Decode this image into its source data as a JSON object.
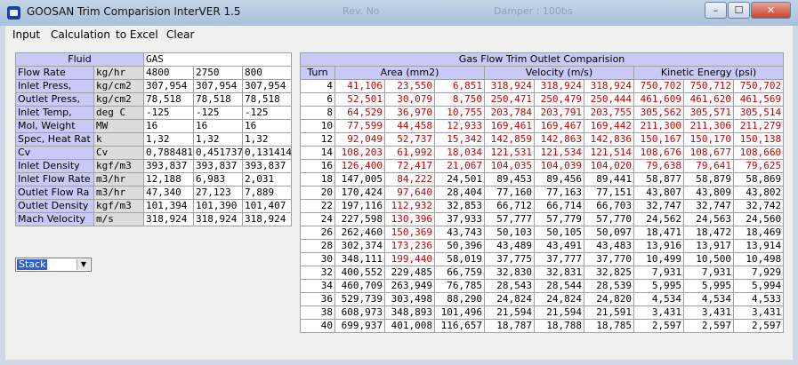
{
  "window": {
    "title": "GOOSAN Trim Comparision InterVER 1.5",
    "minimize": "–",
    "maximize": "☐",
    "close": "✕",
    "background_text": [
      "Rev. No",
      "Damper : 100bs"
    ]
  },
  "menu": [
    "Input",
    "Calculation",
    "to Excel",
    "Clear"
  ],
  "fluid_table": {
    "header_label": "Fluid",
    "header_value": "GAS",
    "rows": [
      {
        "label": "Flow Rate",
        "unit": "kg/hr",
        "values": [
          "4800",
          "2750",
          "800"
        ]
      },
      {
        "label": "Inlet Press,",
        "unit": "kg/cm2",
        "values": [
          "307,954",
          "307,954",
          "307,954"
        ]
      },
      {
        "label": "Outlet Press,",
        "unit": "kg/cm2",
        "values": [
          "78,518",
          "78,518",
          "78,518"
        ]
      },
      {
        "label": "Inlet Temp,",
        "unit": "deg C",
        "values": [
          "-125",
          "-125",
          "-125"
        ]
      },
      {
        "label": "Mol, Weight",
        "unit": "MW",
        "values": [
          "16",
          "16",
          "16"
        ]
      },
      {
        "label": "Spec, Heat Rat",
        "unit": "k",
        "values": [
          "1,32",
          "1,32",
          "1,32"
        ]
      },
      {
        "label": "Cv",
        "unit": "Cv",
        "values": [
          "0,788481",
          "0,451737",
          "0,131414"
        ]
      },
      {
        "label": "Inlet Density",
        "unit": "kgf/m3",
        "values": [
          "393,837",
          "393,837",
          "393,837"
        ]
      },
      {
        "label": "Inlet Flow Rate",
        "unit": "m3/hr",
        "values": [
          "12,188",
          "6,983",
          "2,031"
        ]
      },
      {
        "label": "Outlet Flow Ra",
        "unit": "m3/hr",
        "values": [
          "47,340",
          "27,123",
          "7,889"
        ]
      },
      {
        "label": "Outlet Density",
        "unit": "kgf/m3",
        "values": [
          "101,394",
          "101,390",
          "101,407"
        ]
      },
      {
        "label": "Mach Velocity",
        "unit": "m/s",
        "values": [
          "318,924",
          "318,924",
          "318,924"
        ]
      }
    ]
  },
  "combo": {
    "selected": "Stack"
  },
  "comparison": {
    "title": "Gas Flow Trim Outlet Comparision",
    "col_turn": "Turn",
    "groups": [
      "Area (mm2)",
      "Velocity (m/s)",
      "Kinetic Energy (psi)"
    ],
    "rows": [
      {
        "turn": "4",
        "v": [
          "41,106",
          "23,550",
          "6,851",
          "318,924",
          "318,924",
          "318,924",
          "750,702",
          "750,712",
          "750,702"
        ],
        "red": [
          1,
          1,
          1,
          1,
          1,
          1,
          1,
          1,
          1
        ]
      },
      {
        "turn": "6",
        "v": [
          "52,501",
          "30,079",
          "8,750",
          "250,471",
          "250,479",
          "250,444",
          "461,609",
          "461,620",
          "461,569"
        ],
        "red": [
          1,
          1,
          1,
          1,
          1,
          1,
          1,
          1,
          1
        ]
      },
      {
        "turn": "8",
        "v": [
          "64,529",
          "36,970",
          "10,755",
          "203,784",
          "203,791",
          "203,755",
          "305,562",
          "305,571",
          "305,514"
        ],
        "red": [
          1,
          1,
          1,
          1,
          1,
          1,
          1,
          1,
          1
        ]
      },
      {
        "turn": "10",
        "v": [
          "77,599",
          "44,458",
          "12,933",
          "169,461",
          "169,467",
          "169,442",
          "211,300",
          "211,306",
          "211,279"
        ],
        "red": [
          1,
          1,
          1,
          1,
          1,
          1,
          1,
          1,
          1
        ]
      },
      {
        "turn": "12",
        "v": [
          "92,049",
          "52,737",
          "15,342",
          "142,859",
          "142,863",
          "142,836",
          "150,167",
          "150,170",
          "150,138"
        ],
        "red": [
          1,
          1,
          1,
          1,
          1,
          1,
          1,
          1,
          1
        ]
      },
      {
        "turn": "14",
        "v": [
          "108,203",
          "61,992",
          "18,034",
          "121,531",
          "121,534",
          "121,514",
          "108,676",
          "108,677",
          "108,660"
        ],
        "red": [
          1,
          1,
          1,
          1,
          1,
          1,
          1,
          1,
          1
        ]
      },
      {
        "turn": "16",
        "v": [
          "126,400",
          "72,417",
          "21,067",
          "104,035",
          "104,039",
          "104,020",
          "79,638",
          "79,641",
          "79,625"
        ],
        "red": [
          1,
          1,
          1,
          1,
          1,
          1,
          1,
          1,
          1
        ]
      },
      {
        "turn": "18",
        "v": [
          "147,005",
          "84,222",
          "24,501",
          "89,453",
          "89,456",
          "89,441",
          "58,877",
          "58,879",
          "58,869"
        ],
        "red": [
          0,
          1,
          0,
          0,
          0,
          0,
          0,
          0,
          0
        ]
      },
      {
        "turn": "20",
        "v": [
          "170,424",
          "97,640",
          "28,404",
          "77,160",
          "77,163",
          "77,151",
          "43,807",
          "43,809",
          "43,802"
        ],
        "red": [
          0,
          1,
          0,
          0,
          0,
          0,
          0,
          0,
          0
        ]
      },
      {
        "turn": "22",
        "v": [
          "197,116",
          "112,932",
          "32,853",
          "66,712",
          "66,714",
          "66,703",
          "32,747",
          "32,747",
          "32,742"
        ],
        "red": [
          0,
          1,
          0,
          0,
          0,
          0,
          0,
          0,
          0
        ]
      },
      {
        "turn": "24",
        "v": [
          "227,598",
          "130,396",
          "37,933",
          "57,777",
          "57,779",
          "57,770",
          "24,562",
          "24,563",
          "24,560"
        ],
        "red": [
          0,
          1,
          0,
          0,
          0,
          0,
          0,
          0,
          0
        ]
      },
      {
        "turn": "26",
        "v": [
          "262,460",
          "150,369",
          "43,743",
          "50,103",
          "50,105",
          "50,097",
          "18,471",
          "18,472",
          "18,469"
        ],
        "red": [
          0,
          1,
          0,
          0,
          0,
          0,
          0,
          0,
          0
        ]
      },
      {
        "turn": "28",
        "v": [
          "302,374",
          "173,236",
          "50,396",
          "43,489",
          "43,491",
          "43,483",
          "13,916",
          "13,917",
          "13,914"
        ],
        "red": [
          0,
          1,
          0,
          0,
          0,
          0,
          0,
          0,
          0
        ]
      },
      {
        "turn": "30",
        "v": [
          "348,111",
          "199,440",
          "58,019",
          "37,775",
          "37,777",
          "37,770",
          "10,499",
          "10,500",
          "10,498"
        ],
        "red": [
          0,
          1,
          0,
          0,
          0,
          0,
          0,
          0,
          0
        ]
      },
      {
        "turn": "32",
        "v": [
          "400,552",
          "229,485",
          "66,759",
          "32,830",
          "32,831",
          "32,825",
          "7,931",
          "7,931",
          "7,929"
        ],
        "red": [
          0,
          0,
          0,
          0,
          0,
          0,
          0,
          0,
          0
        ]
      },
      {
        "turn": "34",
        "v": [
          "460,709",
          "263,949",
          "76,785",
          "28,543",
          "28,544",
          "28,539",
          "5,995",
          "5,995",
          "5,994"
        ],
        "red": [
          0,
          0,
          0,
          0,
          0,
          0,
          0,
          0,
          0
        ]
      },
      {
        "turn": "36",
        "v": [
          "529,739",
          "303,498",
          "88,290",
          "24,824",
          "24,824",
          "24,820",
          "4,534",
          "4,534",
          "4,533"
        ],
        "red": [
          0,
          0,
          0,
          0,
          0,
          0,
          0,
          0,
          0
        ]
      },
      {
        "turn": "38",
        "v": [
          "608,973",
          "348,893",
          "101,496",
          "21,594",
          "21,594",
          "21,591",
          "3,431",
          "3,431",
          "3,431"
        ],
        "red": [
          0,
          0,
          0,
          0,
          0,
          0,
          0,
          0,
          0
        ]
      },
      {
        "turn": "40",
        "v": [
          "699,937",
          "401,008",
          "116,657",
          "18,787",
          "18,788",
          "18,785",
          "2,597",
          "2,597",
          "2,597"
        ],
        "red": [
          0,
          0,
          0,
          0,
          0,
          0,
          0,
          0,
          0
        ]
      }
    ]
  }
}
